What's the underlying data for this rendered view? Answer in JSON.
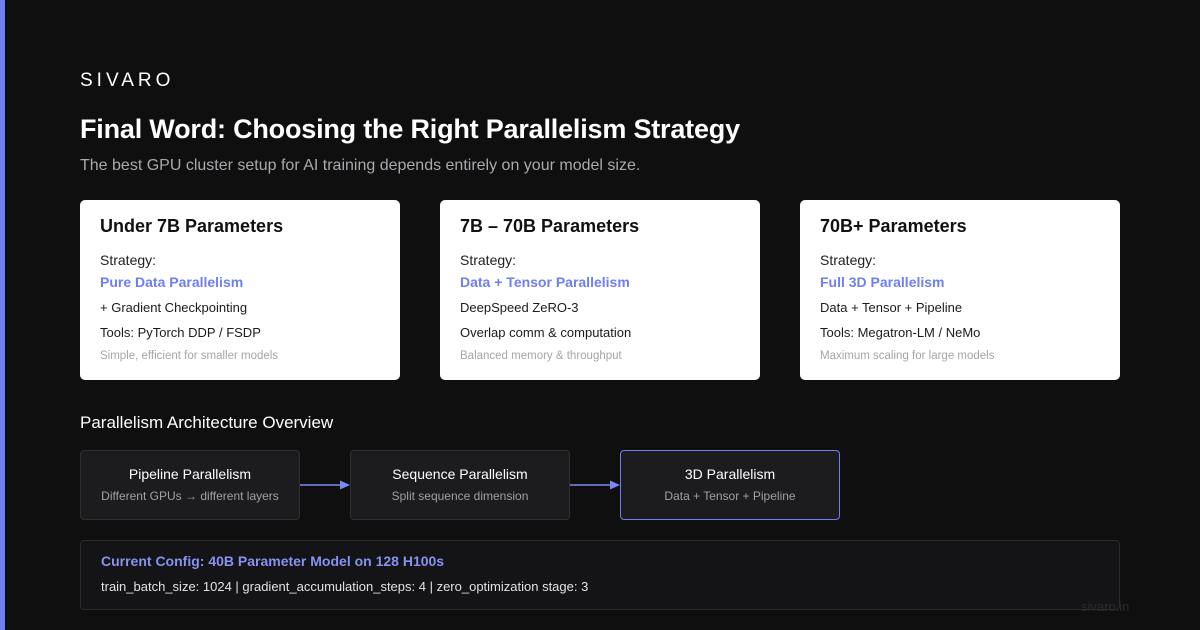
{
  "brand": "SIVARO",
  "title": "Final Word: Choosing the Right Parallelism Strategy",
  "subtitle": "The best GPU cluster setup for AI training depends entirely on your model size.",
  "colors": {
    "accent": "#6f7ef0",
    "background": "#0f0f10",
    "card": "#ffffff"
  },
  "cards": [
    {
      "title": "Under 7B Parameters",
      "label": "Strategy:",
      "strategy": "Pure Data Parallelism",
      "line1": "+ Gradient Checkpointing",
      "line2": "Tools: PyTorch DDP / FSDP",
      "note": "Simple, efficient for smaller models"
    },
    {
      "title": "7B – 70B Parameters",
      "label": "Strategy:",
      "strategy": "Data + Tensor Parallelism",
      "line1": "DeepSpeed ZeRO-3",
      "line2": "Overlap comm & computation",
      "note": "Balanced memory & throughput"
    },
    {
      "title": "70B+ Parameters",
      "label": "Strategy:",
      "strategy": "Full 3D Parallelism",
      "line1": "Data + Tensor + Pipeline",
      "line2": "Tools: Megatron-LM / NeMo",
      "note": "Maximum scaling for large models"
    }
  ],
  "overview": {
    "title": "Parallelism Architecture Overview",
    "nodes": [
      {
        "title": "Pipeline Parallelism",
        "sub": "Different GPUs → different layers"
      },
      {
        "title": "Sequence Parallelism",
        "sub": "Split sequence dimension"
      },
      {
        "title": "3D Parallelism",
        "sub": "Data + Tensor + Pipeline"
      }
    ]
  },
  "config": {
    "title": "Current Config: 40B Parameter Model on 128 H100s",
    "body": "train_batch_size: 1024 | gradient_accumulation_steps: 4 | zero_optimization stage: 3"
  },
  "watermark": "sivaro.in"
}
